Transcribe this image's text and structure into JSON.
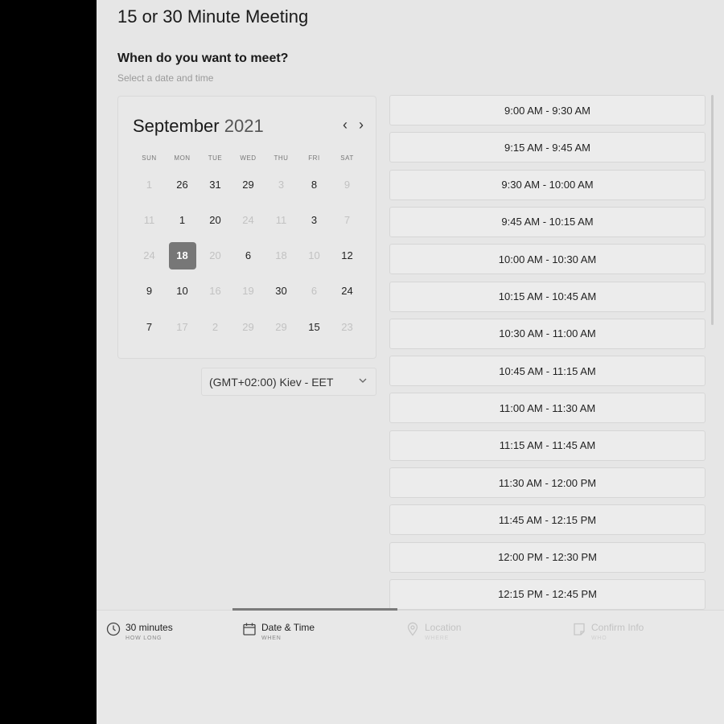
{
  "page": {
    "title": "15 or 30 Minute Meeting",
    "question": "When do you want to meet?",
    "subtitle": "Select a date and time"
  },
  "calendar": {
    "month": "September",
    "year": "2021",
    "prev_label": "‹",
    "next_label": "›",
    "weekdays": [
      "SUN",
      "MON",
      "TUE",
      "WED",
      "THU",
      "FRI",
      "SAT"
    ],
    "weeks": [
      [
        {
          "d": "1",
          "off": true
        },
        {
          "d": "26"
        },
        {
          "d": "31"
        },
        {
          "d": "29"
        },
        {
          "d": "3",
          "off": true
        },
        {
          "d": "8"
        },
        {
          "d": "9",
          "off": true
        }
      ],
      [
        {
          "d": "11",
          "off": true
        },
        {
          "d": "1"
        },
        {
          "d": "20"
        },
        {
          "d": "24",
          "off": true
        },
        {
          "d": "11",
          "off": true
        },
        {
          "d": "3"
        },
        {
          "d": "7",
          "off": true
        }
      ],
      [
        {
          "d": "24",
          "off": true
        },
        {
          "d": "18",
          "selected": true
        },
        {
          "d": "20",
          "off": true
        },
        {
          "d": "6"
        },
        {
          "d": "18",
          "off": true
        },
        {
          "d": "10",
          "off": true
        },
        {
          "d": "12"
        }
      ],
      [
        {
          "d": "9"
        },
        {
          "d": "10"
        },
        {
          "d": "16",
          "off": true
        },
        {
          "d": "19",
          "off": true
        },
        {
          "d": "30"
        },
        {
          "d": "6",
          "off": true
        },
        {
          "d": "24"
        }
      ],
      [
        {
          "d": "7"
        },
        {
          "d": "17",
          "off": true
        },
        {
          "d": "2",
          "off": true
        },
        {
          "d": "29",
          "off": true
        },
        {
          "d": "29",
          "off": true
        },
        {
          "d": "15"
        },
        {
          "d": "23",
          "off": true
        }
      ]
    ]
  },
  "timezone": {
    "value": "(GMT+02:00) Kiev - EET"
  },
  "slots": [
    "9:00 AM - 9:30 AM",
    "9:15 AM - 9:45 AM",
    "9:30 AM - 10:00 AM",
    "9:45 AM - 10:15 AM",
    "10:00 AM - 10:30 AM",
    "10:15 AM - 10:45 AM",
    "10:30 AM - 11:00 AM",
    "10:45 AM - 11:15 AM",
    "11:00 AM - 11:30 AM",
    "11:15 AM - 11:45 AM",
    "11:30 AM - 12:00 PM",
    "11:45 AM - 12:15 PM",
    "12:00 PM - 12:30 PM",
    "12:15 PM - 12:45 PM"
  ],
  "tabs": [
    {
      "label": "30 minutes",
      "sub": "HOW LONG",
      "icon": "clock-icon",
      "state": "done"
    },
    {
      "label": "Date & Time",
      "sub": "WHEN",
      "icon": "calendar-icon",
      "state": "active"
    },
    {
      "label": "Location",
      "sub": "WHERE",
      "icon": "location-pin-icon",
      "state": "disabled"
    },
    {
      "label": "Confirm Info",
      "sub": "WHO",
      "icon": "note-icon",
      "state": "disabled"
    }
  ]
}
